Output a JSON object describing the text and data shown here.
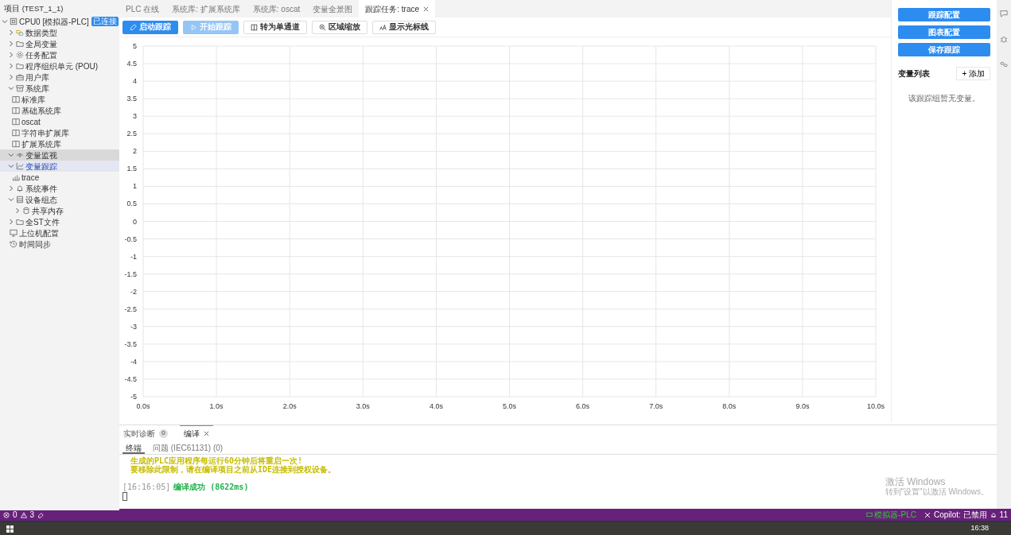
{
  "sidebar": {
    "title": "项目 (TEST_1_1)",
    "tree": [
      {
        "label": "CPU0 [模拟器-PLC]",
        "badge": "已连接",
        "kind": "cpu",
        "expanded": true,
        "selected": false,
        "hovered": false,
        "children": [
          {
            "label": "数据类型",
            "kind": "tag",
            "expanded": false,
            "selected": false,
            "hovered": false
          },
          {
            "label": "全局变量",
            "kind": "folder",
            "expanded": false,
            "selected": false,
            "hovered": false
          },
          {
            "label": "任务配置",
            "kind": "gear",
            "expanded": false,
            "selected": false,
            "hovered": false
          },
          {
            "label": "程序组织单元 (POU)",
            "kind": "folder",
            "expanded": false,
            "selected": false,
            "hovered": false
          },
          {
            "label": "用户库",
            "kind": "briefcase",
            "expanded": false,
            "selected": false,
            "hovered": false
          },
          {
            "label": "系统库",
            "kind": "archive",
            "expanded": true,
            "selected": false,
            "hovered": false,
            "children": [
              {
                "label": "标准库",
                "kind": "book",
                "selected": false,
                "hovered": false
              },
              {
                "label": "基础系统库",
                "kind": "book",
                "selected": false,
                "hovered": false
              },
              {
                "label": "oscat",
                "kind": "book",
                "selected": false,
                "hovered": false
              },
              {
                "label": "字符串扩展库",
                "kind": "book",
                "selected": false,
                "hovered": false
              },
              {
                "label": "扩展系统库",
                "kind": "book",
                "selected": false,
                "hovered": false
              }
            ]
          },
          {
            "label": "变量监视",
            "kind": "eye",
            "expanded": true,
            "selected": false,
            "hovered": true
          },
          {
            "label": "变量跟踪",
            "kind": "chart",
            "expanded": true,
            "selected": true,
            "hovered": false,
            "children": [
              {
                "label": "trace",
                "kind": "bars",
                "selected": false,
                "hovered": false
              }
            ]
          },
          {
            "label": "系统事件",
            "kind": "bell",
            "expanded": false,
            "selected": false,
            "hovered": false
          },
          {
            "label": "设备组态",
            "kind": "list",
            "expanded": true,
            "selected": false,
            "hovered": false,
            "children": [
              {
                "label": "共享内存",
                "kind": "cylinder",
                "expanded": false,
                "selected": false,
                "hovered": false
              }
            ]
          },
          {
            "label": "全ST文件",
            "kind": "folder",
            "expanded": false,
            "selected": false,
            "hovered": false
          },
          {
            "label": "上位机配置",
            "kind": "monitor",
            "selected": false,
            "hovered": false
          },
          {
            "label": "时间同步",
            "kind": "clock",
            "selected": false,
            "hovered": false
          }
        ]
      }
    ]
  },
  "editor_tabs": [
    {
      "label": "PLC 在线",
      "selected": false,
      "closable": false
    },
    {
      "label": "系统库: 扩展系统库",
      "selected": false,
      "closable": false
    },
    {
      "label": "系统库: oscat",
      "selected": false,
      "closable": false
    },
    {
      "label": "变量全景图",
      "selected": false,
      "closable": false
    },
    {
      "label": "跟踪任务: trace",
      "selected": true,
      "closable": true
    }
  ],
  "toolbar": [
    {
      "label": "启动跟踪",
      "kind": "primary",
      "disabled": false
    },
    {
      "label": "开始跟踪",
      "kind": "primary",
      "disabled": true
    },
    {
      "label": "转为单通道",
      "kind": "default",
      "disabled": false
    },
    {
      "label": "区域缩放",
      "kind": "default",
      "disabled": false
    },
    {
      "label": "显示光标线",
      "kind": "default",
      "disabled": false
    }
  ],
  "chart_data": {
    "type": "line",
    "grid": true,
    "xlim": [
      0,
      10
    ],
    "ylim": [
      -5,
      5
    ],
    "xticks": [
      {
        "value": 0,
        "label": "0.0s"
      },
      {
        "value": 1,
        "label": "1.0s"
      },
      {
        "value": 2,
        "label": "2.0s"
      },
      {
        "value": 3,
        "label": "3.0s"
      },
      {
        "value": 4,
        "label": "4.0s"
      },
      {
        "value": 5,
        "label": "5.0s"
      },
      {
        "value": 6,
        "label": "6.0s"
      },
      {
        "value": 7,
        "label": "7.0s"
      },
      {
        "value": 8,
        "label": "8.0s"
      },
      {
        "value": 9,
        "label": "9.0s"
      },
      {
        "value": 10,
        "label": "10.0s"
      }
    ],
    "yticks": [
      5,
      4.5,
      4,
      3.5,
      3,
      2.5,
      2,
      1.5,
      1,
      0.5,
      0,
      -0.5,
      -1,
      -1.5,
      -2,
      -2.5,
      -3,
      -3.5,
      -4,
      -4.5,
      -5
    ]
  },
  "right_panel": {
    "buttons": [
      "跟踪配置",
      "图表配置",
      "保存跟踪"
    ],
    "variables_title": "变量列表",
    "add_button": "+ 添加",
    "empty_text": "该跟踪组暂无变量。"
  },
  "bottom_panel": {
    "tabs": [
      {
        "label": "实时诊断",
        "badge": "0",
        "selected": false,
        "closable": false
      },
      {
        "label": "编译",
        "selected": true,
        "closable": true
      }
    ],
    "subtabs": [
      {
        "label": "终端",
        "selected": true
      },
      {
        "label": "问题 (IEC61131) (0)",
        "selected": false
      }
    ],
    "lines": [
      {
        "kind": "warning",
        "text": "生成的PLC应用程序每运行60分钟后将重启一次!"
      },
      {
        "kind": "warning",
        "text": "要移除此限制，请在编译项目之前从IDE连接到授权设备。"
      },
      {
        "kind": "blank"
      },
      {
        "kind": "success",
        "time": "[16:16:05]",
        "text": "编译成功 (8622ms)"
      }
    ]
  },
  "watermark_os": {
    "title": "激活 Windows",
    "subtitle": "转到\"设置\"以激活 Windows。"
  },
  "status_bar": {
    "errors": "0",
    "warnings": "3",
    "connection": "模拟器-PLC",
    "copilot": "Copilot: 已禁用",
    "notifications": "11"
  },
  "taskbar": {
    "clock": "16:38"
  }
}
